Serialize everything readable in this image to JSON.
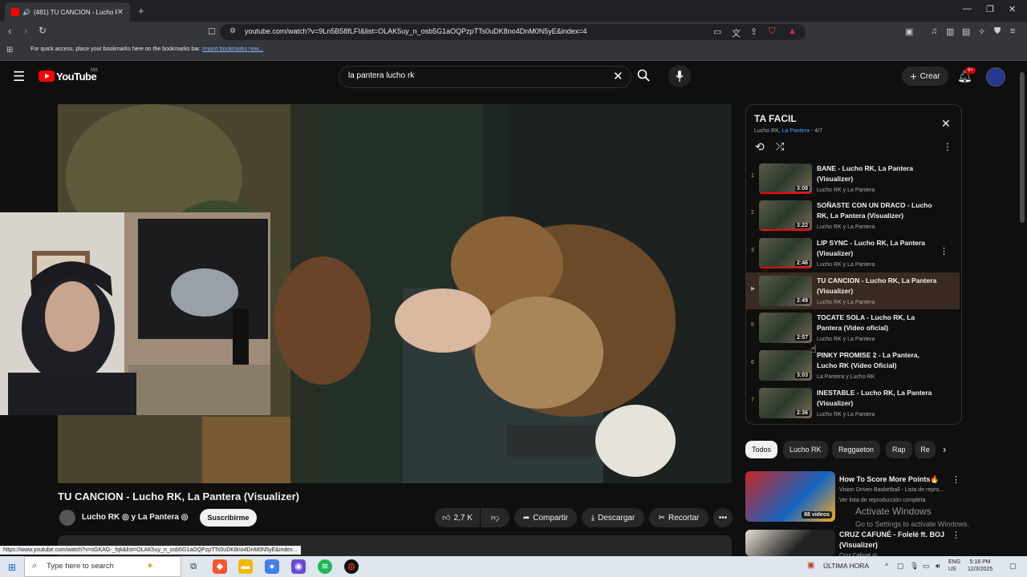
{
  "browser": {
    "tab_title": "(481) TU CANCION - Lucho R",
    "tab_close": "✕",
    "new_tab": "+",
    "url": "youtube.com/watch?v=9Ln5B58fLFI&list=OLAK5uy_n_osb5G1aOQPzpTTs0uDK8no4DnM0N5yE&index=4",
    "bookmarks_text": "For quick access, place your bookmarks here on the bookmarks bar.",
    "bookmarks_link": "Import bookmarks now...",
    "status_url": "https://www.youtube.com/watch?v=sGKAG-_fqk&list=OLAK5uy_n_osb5G1aOQPzpTTs0uDK8no4DnM0N5yE&index..."
  },
  "header": {
    "logo_text": "YouTube",
    "logo_region": "MX",
    "search_query": "la pantera lucho rk",
    "create_label": "Crear",
    "notif_badge": "9+"
  },
  "video": {
    "title": "TU CANCION - Lucho RK, La Pantera (Visualizer)",
    "channel": "Lucho RK ◎ y La Pantera ◎",
    "subscribe_label": "Suscribirme",
    "likes": "2,7 K",
    "share_label": "Compartir",
    "download_label": "Descargar",
    "clip_label": "Recortar"
  },
  "playlist": {
    "title": "TA FACIL",
    "artist_a": "Lucho RK,",
    "artist_b": "La Pantera",
    "position": "- 4/7",
    "items": [
      {
        "num": "1",
        "title": "BANE - Lucho RK, La Pantera (Visualizer)",
        "channel": "Lucho RK y La Pantera",
        "duration": "3:08"
      },
      {
        "num": "2",
        "title": "SOÑASTE CON UN DRACO - Lucho RK, La Pantera (Visualizer)",
        "channel": "Lucho RK y La Pantera",
        "duration": "3:22"
      },
      {
        "num": "3",
        "title": "LIP SYNC - Lucho RK, La Pantera (Visualizer)",
        "channel": "Lucho RK y La Pantera",
        "duration": "2:46"
      },
      {
        "num": "▶",
        "title": "TU CANCION - Lucho RK, La Pantera (Visualizer)",
        "channel": "Lucho RK y La Pantera",
        "duration": "2:49"
      },
      {
        "num": "5",
        "title": "TOCATE SOLA - Lucho RK, La Pantera (Video oficial)",
        "channel": "Lucho RK y La Pantera",
        "duration": "2:57"
      },
      {
        "num": "6",
        "title": "PINKY PROMISE 2 - La Pantera, Lucho RK (Video Oficial)",
        "channel": "La Pantera y Lucho RK",
        "duration": "3:03"
      },
      {
        "num": "7",
        "title": "INESTABLE - Lucho RK, La Pantera (Visualizer)",
        "channel": "Lucho RK y La Pantera",
        "duration": "2:36"
      }
    ]
  },
  "chips": [
    "Todos",
    "Lucho RK",
    "Reggaeton",
    "Rap",
    "Re"
  ],
  "recommendations": [
    {
      "title": "How To Score More Points🔥",
      "line1": "Vision Driven Basketball - Lista de repro...",
      "line2": "Ver lista de reproducción completa",
      "badge": "88 videos"
    },
    {
      "title": "CRUZ CAFUNÉ - Folelé ft. BOJ (Visualizer)",
      "line1": "Cruz Cafuné ◎",
      "line2": "",
      "badge": ""
    }
  ],
  "windows_activate": {
    "line1": "Activate Windows",
    "line2": "Go to Settings to activate Windows."
  },
  "taskbar": {
    "search_placeholder": "Type here to search",
    "weather": "ÚLTIMA HORA",
    "lang1": "ENG",
    "lang2": "US",
    "time": "5:16 PM",
    "date": "12/3/2025"
  }
}
